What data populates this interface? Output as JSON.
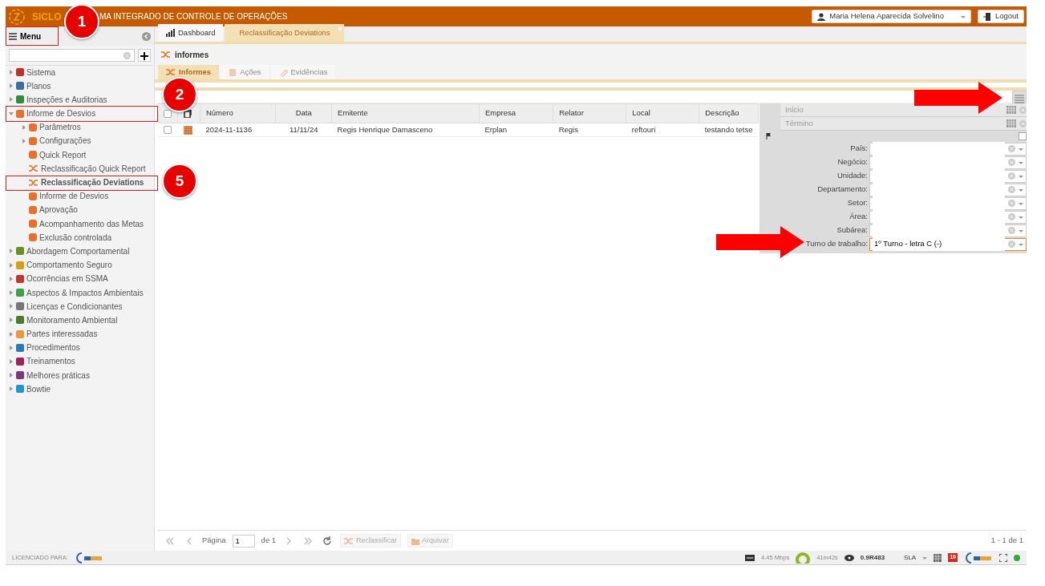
{
  "header": {
    "logo": "SICLO",
    "title": "MA INTEGRADO DE CONTROLE DE OPERAÇÕES",
    "user": "Maria Helena Aparecida Solvelino",
    "logout": "Logout"
  },
  "menu": {
    "label": "Menu"
  },
  "sidebar": {
    "items": [
      {
        "label": "Sistema",
        "expanded": false
      },
      {
        "label": "Planos",
        "expanded": false
      },
      {
        "label": "Inspeções e Auditorias",
        "expanded": false
      },
      {
        "label": "Informe de Desvios",
        "expanded": true,
        "children": [
          {
            "label": "Parâmetros",
            "expanded": false,
            "selected": false
          },
          {
            "label": "Configurações",
            "expanded": false,
            "selected": false
          },
          {
            "label": "Quick Report",
            "selected": false
          },
          {
            "label": "Reclassificação Quick Report",
            "selected": false
          },
          {
            "label": "Reclassificação Deviations",
            "selected": true
          },
          {
            "label": "Informe de Desvios",
            "selected": false
          },
          {
            "label": "Aprovação",
            "selected": false
          },
          {
            "label": "Acompanhamento das Metas",
            "selected": false
          },
          {
            "label": "Exclusão controlada",
            "selected": false
          }
        ]
      },
      {
        "label": "Abordagem Comportamental",
        "expanded": false
      },
      {
        "label": "Comportamento Seguro",
        "expanded": false
      },
      {
        "label": "Ocorrências em SSMA",
        "expanded": false
      },
      {
        "label": "Aspectos & Impactos Ambientais",
        "expanded": false
      },
      {
        "label": "Licenças e Condicionantes",
        "expanded": false
      },
      {
        "label": "Monitoramento Ambiental",
        "expanded": false
      },
      {
        "label": "Partes interessadas",
        "expanded": false
      },
      {
        "label": "Procedimentos",
        "expanded": false
      },
      {
        "label": "Treinamentos",
        "expanded": false
      },
      {
        "label": "Melhores práticas",
        "expanded": false
      },
      {
        "label": "Bowtie",
        "expanded": false
      }
    ]
  },
  "tabs": [
    {
      "label": "Dashboard",
      "selected": false
    },
    {
      "label": "Reclassificação Deviations",
      "selected": true
    }
  ],
  "page_title": "informes",
  "subtabs": [
    {
      "label": "Informes",
      "selected": true,
      "disabled": false
    },
    {
      "label": "Ações",
      "selected": false,
      "disabled": true
    },
    {
      "label": "Evidências",
      "selected": false,
      "disabled": true
    }
  ],
  "table": {
    "columns": [
      "Número",
      "Data",
      "Emitente",
      "Empresa",
      "Relator",
      "Local",
      "Descrição"
    ],
    "all_checked": false,
    "rows": [
      {
        "checked": false,
        "cells": [
          "2024-11-1136",
          "11/11/24",
          "Regis Henrique Damasceno",
          "Erplan",
          "Regis",
          "reftouri",
          "testando tetse"
        ]
      }
    ]
  },
  "filters": {
    "dates": [
      {
        "placeholder": "Início"
      },
      {
        "placeholder": "Término"
      }
    ],
    "checked": false,
    "fields": [
      {
        "label": "País:",
        "focused": false
      },
      {
        "label": "Negócio:",
        "focused": false
      },
      {
        "label": "Unidade:",
        "focused": false
      },
      {
        "label": "Departamento:",
        "focused": false
      },
      {
        "label": "Setor:",
        "focused": false
      },
      {
        "label": "Área:",
        "focused": false
      },
      {
        "label": "Subárea:",
        "focused": false
      },
      {
        "label": "Turno de trabalho:",
        "value": "1º Turno - letra C (-)",
        "focused": true
      }
    ]
  },
  "pager": {
    "page_label": "Página",
    "page": "1",
    "of": "de 1",
    "buttons": [
      "Reclassificar",
      "Arquivar"
    ],
    "summary": "1 - 1 de 1"
  },
  "status_bar": {
    "licensed": "LICENCIADO PARA:",
    "speed": "4.45 Mbps",
    "timer": "41m42s",
    "version": "0.9R483",
    "sla": "SLA",
    "count": "10"
  },
  "annotations": [
    {
      "number": "1"
    },
    {
      "number": "2"
    },
    {
      "number": "5"
    }
  ]
}
